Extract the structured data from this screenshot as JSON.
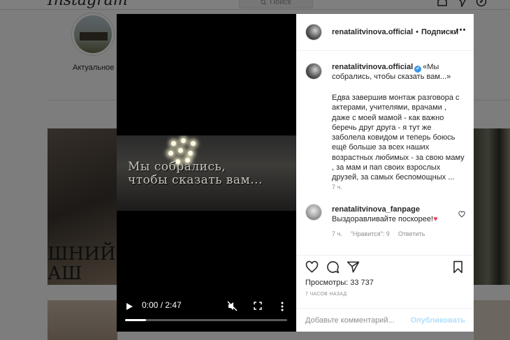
{
  "background": {
    "logo": "Instagram",
    "search_placeholder": "Поиск",
    "highlight_label": "Актуальное",
    "tile_text": "ШНИЙ Д\nАШ"
  },
  "video": {
    "title_line1": "Мы собрались,",
    "title_line2": "чтобы сказать вам...",
    "time": "0:00 / 2:47",
    "progress": 0.13
  },
  "header": {
    "username": "renatalitvinova.official",
    "separator": "•",
    "follow_label": "Подписки"
  },
  "caption": {
    "username": "renatalitvinova.official",
    "verified_mark": "✔",
    "title": "«Мы собрались, чтобы сказать вам...»",
    "body": "Едва завершив монтаж разговора с актерами, учителями, врачами , даже с моей мамой - как важно беречь друг друга - я тут же заболела ковидом и теперь боюсь ещё больше за всех наших возрастных любимых - за свою маму , за мам и пап своих взрослых друзей, за самых беспомощных ...",
    "time": "7 ч."
  },
  "comment": {
    "username": "renatalitvinova_fanpage",
    "text": "Выздоравливайте поскорее!",
    "emoji": "♥",
    "time": "7 ч.",
    "likes": "\"Нравится\": 9",
    "reply": "Ответить"
  },
  "post": {
    "views": "Просмотры: 33 737",
    "date": "7 часов назад",
    "comment_placeholder": "Добавьте комментарий...",
    "post_label": "Опубликовать"
  },
  "colors": {
    "verified": "#3897f0",
    "post_button_disabled": "#b2dffc",
    "heart": "#ed4956"
  }
}
